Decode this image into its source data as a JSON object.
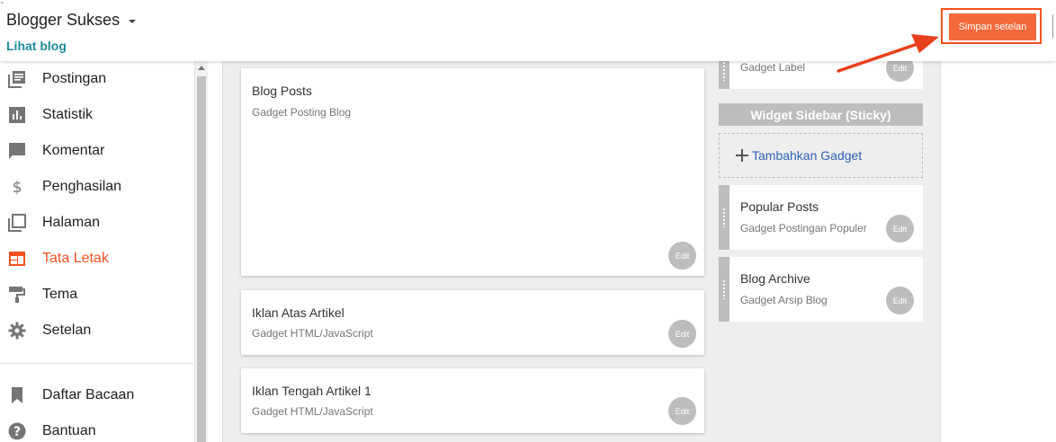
{
  "header": {
    "blog_name": "Blogger Sukses",
    "view_blog": "Lihat blog",
    "save_label": "Simpan setelan",
    "tiny_mark": "\""
  },
  "sidebar": {
    "items": [
      {
        "label": "Postingan",
        "icon": "posts-icon"
      },
      {
        "label": "Statistik",
        "icon": "stats-icon"
      },
      {
        "label": "Komentar",
        "icon": "comment-icon"
      },
      {
        "label": "Penghasilan",
        "icon": "dollar-icon"
      },
      {
        "label": "Halaman",
        "icon": "pages-icon"
      },
      {
        "label": "Tata Letak",
        "icon": "layout-icon",
        "active": true
      },
      {
        "label": "Tema",
        "icon": "paint-roller-icon"
      },
      {
        "label": "Setelan",
        "icon": "gear-icon"
      }
    ],
    "secondary": [
      {
        "label": "Daftar Bacaan",
        "icon": "bookmark-icon"
      },
      {
        "label": "Bantuan",
        "icon": "help-icon"
      }
    ]
  },
  "main": {
    "gadgets": [
      {
        "title": "Blog Posts",
        "subtitle": "Gadget Posting Blog",
        "edit": "Edit"
      },
      {
        "title": "Iklan Atas Artikel",
        "subtitle": "Gadget HTML/JavaScript",
        "edit": "Edit"
      },
      {
        "title": "Iklan Tengah Artikel 1",
        "subtitle": "Gadget HTML/JavaScript",
        "edit": "Edit"
      }
    ]
  },
  "right": {
    "top_gadget": {
      "subtitle": "Gadget Label",
      "edit": "Edit"
    },
    "section_title": "Widget Sidebar (Sticky)",
    "add_gadget": "Tambahkan Gadget",
    "gadgets": [
      {
        "title": "Popular Posts",
        "subtitle": "Gadget Postingan Populer",
        "edit": "Edit"
      },
      {
        "title": "Blog Archive",
        "subtitle": "Gadget Arsip Blog",
        "edit": "Edit"
      }
    ]
  },
  "colors": {
    "accent": "#f4511e",
    "save_button": "#f4683a",
    "link": "#1e8a9c",
    "add_link": "#2f63b7"
  }
}
